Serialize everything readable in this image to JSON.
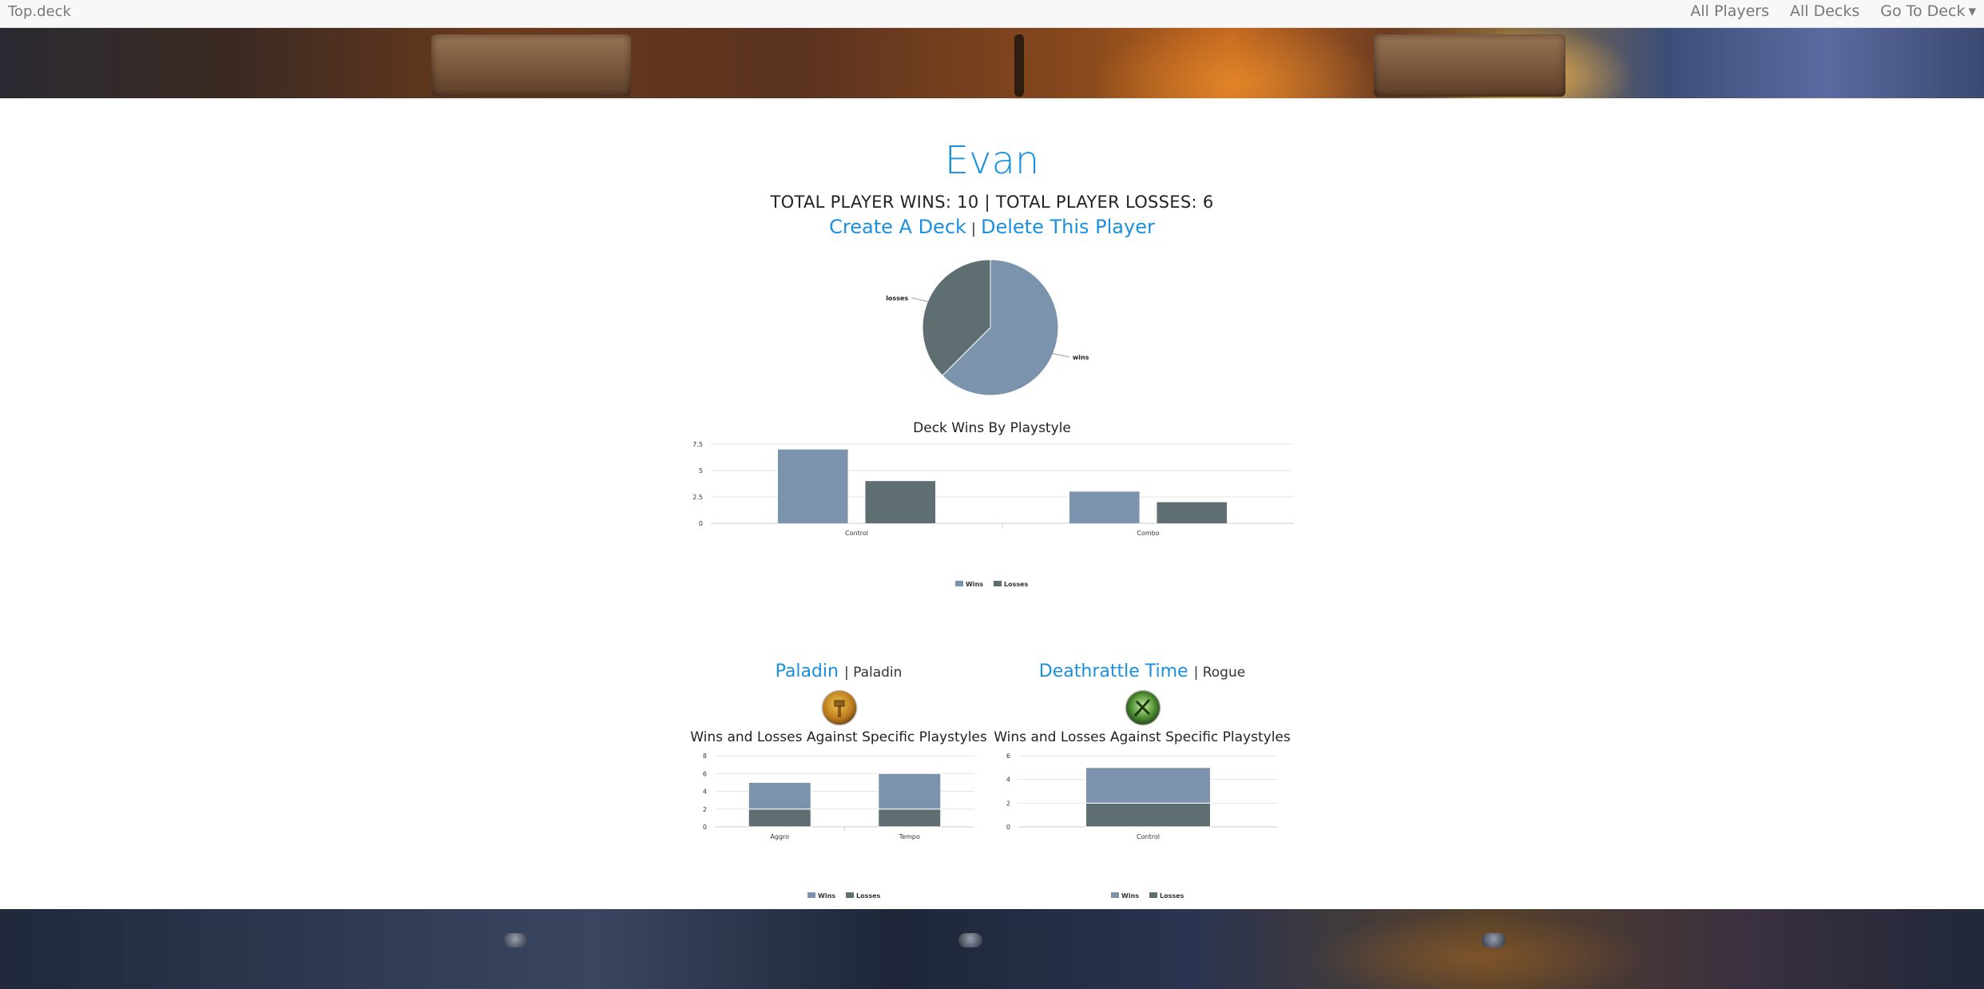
{
  "nav": {
    "brand": "Top.deck",
    "links": [
      "All Players",
      "All Decks",
      "Go To Deck"
    ]
  },
  "player": {
    "name": "Evan",
    "totals": "TOTAL PLAYER WINS: 10 | TOTAL PLAYER LOSSES: 6",
    "create_deck": "Create A Deck",
    "separator": "|",
    "delete_player": "Delete This Player"
  },
  "colors": {
    "wins": "#7b93ad",
    "losses": "#5f6e70",
    "link": "#1a90e0"
  },
  "pie": {
    "chart_data": {
      "type": "pie",
      "labels": [
        "wins",
        "losses"
      ],
      "values": [
        10,
        6
      ]
    }
  },
  "playstyle_chart": {
    "title": "Deck Wins By Playstyle",
    "chart_data": {
      "type": "bar",
      "categories": [
        "Control",
        "Combo"
      ],
      "series": [
        {
          "name": "Wins",
          "values": [
            7,
            3
          ]
        },
        {
          "name": "Losses",
          "values": [
            4,
            2
          ]
        }
      ],
      "ylim": [
        0,
        7.5
      ],
      "yticks": [
        "0",
        "2.5",
        "5",
        "7.5"
      ],
      "legend": "bottom"
    }
  },
  "decks": [
    {
      "name": "Paladin",
      "class": "| Paladin",
      "icon": "paladin-class-icon",
      "subtitle": "Wins and Losses Against Specific Playstyles",
      "chart_data": {
        "type": "bar",
        "stacked": true,
        "categories": [
          "Aggro",
          "Tempo"
        ],
        "series": [
          {
            "name": "Losses",
            "values": [
              2,
              2
            ]
          },
          {
            "name": "Wins",
            "values": [
              3,
              4
            ]
          }
        ],
        "ylim": [
          0,
          8
        ],
        "yticks": [
          "0",
          "2",
          "4",
          "6",
          "8"
        ],
        "legend": "bottom"
      }
    },
    {
      "name": "Deathrattle Time",
      "class": "| Rogue",
      "icon": "rogue-class-icon",
      "subtitle": "Wins and Losses Against Specific Playstyles",
      "chart_data": {
        "type": "bar",
        "stacked": true,
        "categories": [
          "Control"
        ],
        "series": [
          {
            "name": "Losses",
            "values": [
              2
            ]
          },
          {
            "name": "Wins",
            "values": [
              3
            ]
          }
        ],
        "ylim": [
          0,
          6
        ],
        "yticks": [
          "0",
          "2",
          "4",
          "6"
        ],
        "legend": "bottom"
      }
    }
  ],
  "legend": {
    "wins": "Wins",
    "losses": "Losses"
  }
}
